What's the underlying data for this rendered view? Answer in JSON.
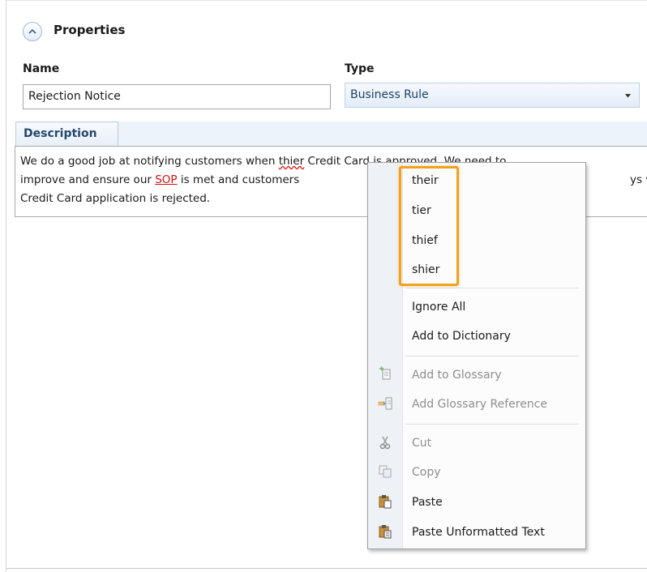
{
  "properties": {
    "section_title": "Properties",
    "name_label": "Name",
    "name_value": "Rejection Notice",
    "type_label": "Type",
    "type_value": "Business Rule"
  },
  "description": {
    "tab_label": "Description",
    "line1_a": "We do a good job at notifying customers when ",
    "line1_err": "thier",
    "line1_b": " Credit Card is approved. We need to",
    "line2_a": "improve and ensure our ",
    "line2_sop": "SOP",
    "line2_b": " is met and customers",
    "line2_c": "ys when",
    "line3": "Credit Card application is rejected."
  },
  "context_menu": {
    "suggestions": [
      "their",
      "tier",
      "thief",
      "shier"
    ],
    "ignore_all": "Ignore All",
    "add_to_dictionary": "Add to Dictionary",
    "add_to_glossary": "Add to Glossary",
    "add_glossary_reference": "Add Glossary Reference",
    "cut": "Cut",
    "copy": "Copy",
    "paste": "Paste",
    "paste_unformatted": "Paste Unformatted Text"
  },
  "colors": {
    "highlight": "#f2a11f",
    "link_red": "#d01010",
    "accent_blue": "#26476e"
  }
}
